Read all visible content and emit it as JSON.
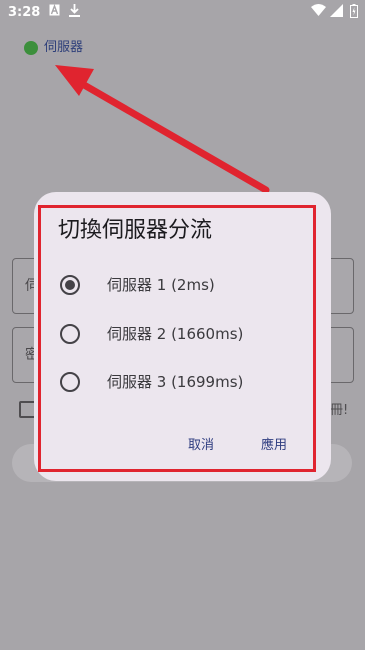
{
  "status_bar": {
    "time": "3:28",
    "icons": [
      "a-box-icon",
      "download-icon",
      "wifi-icon",
      "signal-icon",
      "battery-charging-icon"
    ]
  },
  "server_indicator": {
    "label": "伺服器",
    "status_color": "#3c8f3c"
  },
  "dialog": {
    "title": "切換伺服器分流",
    "options": [
      {
        "label": "伺服器 1 (2ms)",
        "selected": true
      },
      {
        "label": "伺服器 2 (1660ms)",
        "selected": false
      },
      {
        "label": "伺服器 3 (1699ms)",
        "selected": false
      }
    ],
    "cancel_label": "取消",
    "apply_label": "應用"
  },
  "background": {
    "field1_glyph": "伺",
    "field2_glyph": "密",
    "checkbox_tail": "冊!"
  },
  "colors": {
    "highlight": "#e0242f",
    "accent": "#2f3d80"
  }
}
